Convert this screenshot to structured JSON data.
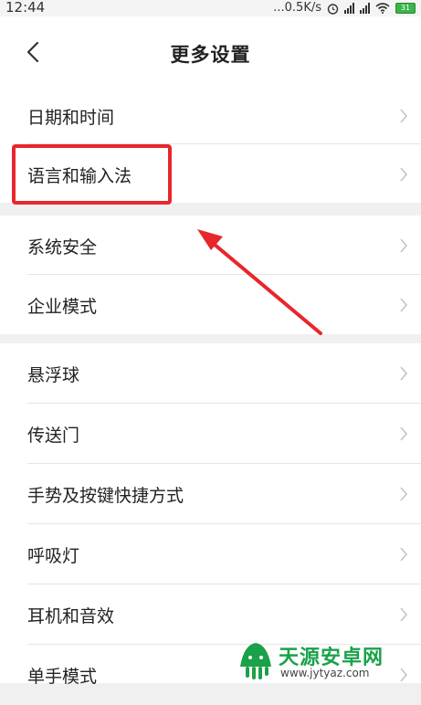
{
  "status_bar": {
    "time": "12:44",
    "network_speed": "...0.5K/s",
    "battery_level": "31",
    "icons": [
      "alarm-icon",
      "signal-icon",
      "signal-icon",
      "wifi-icon",
      "battery-icon"
    ]
  },
  "header": {
    "title": "更多设置",
    "back_icon": "back-arrow-icon"
  },
  "sections": [
    {
      "items": [
        {
          "label": "日期和时间"
        },
        {
          "label": "语言和输入法"
        }
      ]
    },
    {
      "items": [
        {
          "label": "系统安全"
        },
        {
          "label": "企业模式"
        }
      ]
    },
    {
      "items": [
        {
          "label": "悬浮球"
        },
        {
          "label": "传送门"
        },
        {
          "label": "手势及按键快捷方式"
        },
        {
          "label": "呼吸灯"
        },
        {
          "label": "耳机和音效"
        },
        {
          "label": "单手模式"
        }
      ]
    }
  ],
  "annotation": {
    "highlight_color": "#e8262b",
    "highlighted_item": "语言和输入法"
  },
  "watermark": {
    "title": "天源安卓网",
    "url": "www.jytyaz.com",
    "brand_color": "#1aa14a"
  }
}
